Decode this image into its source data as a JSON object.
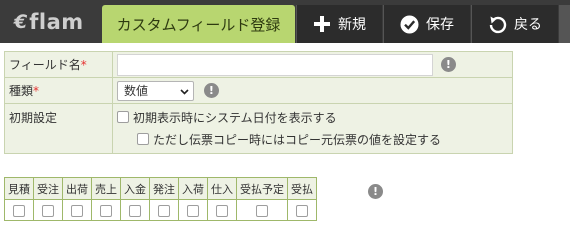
{
  "app": {
    "logo_mark": "€",
    "logo_word": "flam"
  },
  "tabs": {
    "active_label": "カスタムフィールド登録"
  },
  "toolbar": {
    "new_label": "新規",
    "save_label": "保存",
    "back_label": "戻る"
  },
  "form": {
    "field_name": {
      "label": "フィールド名",
      "required_mark": "*",
      "value": ""
    },
    "type": {
      "label": "種類",
      "required_mark": "*",
      "selected": "数値"
    },
    "initial": {
      "label": "初期設定",
      "option1": "初期表示時にシステム日付を表示する",
      "option2": "ただし伝票コピー時にはコピー元伝票の値を設定する"
    }
  },
  "doc_types": {
    "headers": [
      "見積",
      "受注",
      "出荷",
      "売上",
      "入金",
      "発注",
      "入荷",
      "仕入",
      "受払予定",
      "受払"
    ],
    "checked": [
      false,
      false,
      false,
      false,
      false,
      false,
      false,
      false,
      false,
      false
    ]
  },
  "icons": {
    "info": "info-icon",
    "plus": "plus-icon",
    "check": "check-circle-icon",
    "back": "undo-icon"
  },
  "colors": {
    "accent": "#b8d670",
    "topbar": "#3b3b3b",
    "label_bg": "#eef2e4",
    "required": "#e53030"
  }
}
